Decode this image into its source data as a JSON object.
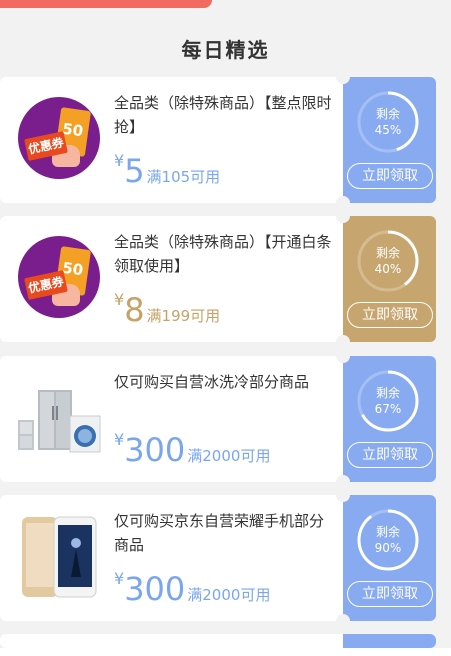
{
  "section": {
    "title": "每日精选"
  },
  "colors": {
    "blue": "#87aaf0",
    "gold": "#c7a56f",
    "blue_text": "#7aa6ee",
    "gold_text": "#c7a266"
  },
  "coupons": [
    {
      "title": "全品类（除特殊商品）【整点限时抢】",
      "currency": "¥",
      "amount": "5",
      "condition": "满105可用",
      "remaining_label": "剩余",
      "remaining_percent": "45%",
      "remaining_fraction": 0.45,
      "theme": "blue",
      "button": "立即领取",
      "image": "coupon-badge-image"
    },
    {
      "title": "全品类（除特殊商品）【开通白条领取使用】",
      "currency": "¥",
      "amount": "8",
      "condition": "满199可用",
      "remaining_label": "剩余",
      "remaining_percent": "40%",
      "remaining_fraction": 0.4,
      "theme": "gold",
      "button": "立即领取",
      "image": "coupon-badge-image"
    },
    {
      "title": "仅可购买自营冰洗冷部分商品",
      "currency": "¥",
      "amount": "300",
      "condition": "满2000可用",
      "remaining_label": "剩余",
      "remaining_percent": "67%",
      "remaining_fraction": 0.67,
      "theme": "blue",
      "button": "立即领取",
      "image": "appliances-image"
    },
    {
      "title": "仅可购买京东自营荣耀手机部分商品",
      "currency": "¥",
      "amount": "300",
      "condition": "满2000可用",
      "remaining_label": "剩余",
      "remaining_percent": "90%",
      "remaining_fraction": 0.9,
      "theme": "blue",
      "button": "立即领取",
      "image": "phone-image"
    }
  ],
  "badge": {
    "text": "优惠券",
    "ticket": "50"
  }
}
